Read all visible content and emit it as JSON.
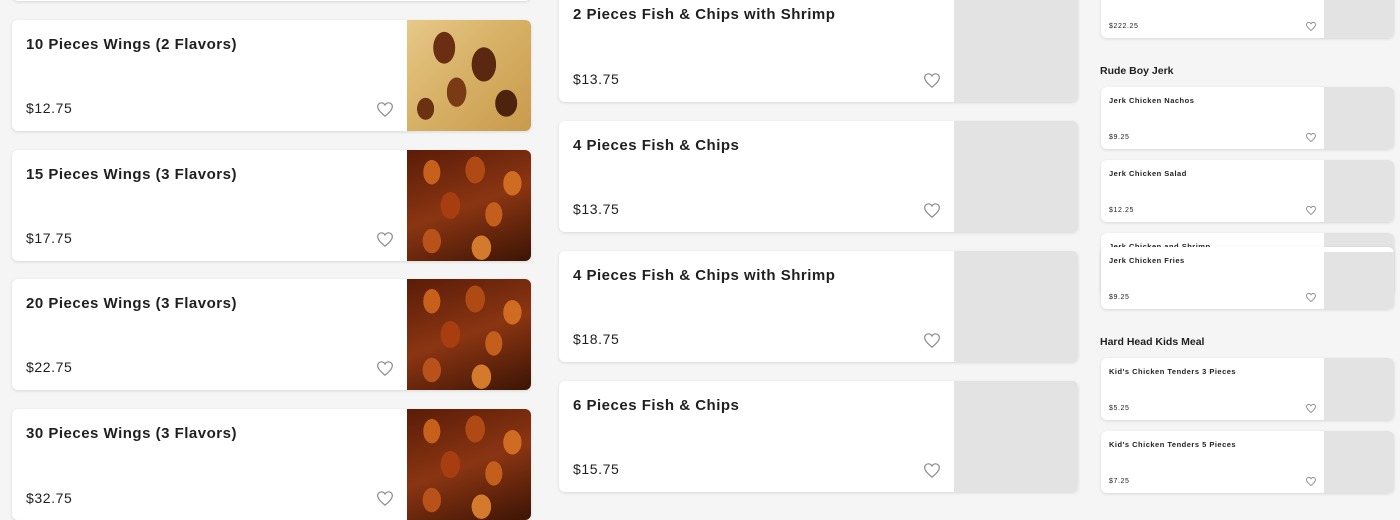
{
  "col1": {
    "items": [
      {
        "name": "10 Pieces Wings (2 Flavors)",
        "price": "$12.75"
      },
      {
        "name": "15 Pieces Wings (3 Flavors)",
        "price": "$17.75"
      },
      {
        "name": "20 Pieces Wings (3 Flavors)",
        "price": "$22.75"
      },
      {
        "name": "30 Pieces Wings (3 Flavors)",
        "price": "$32.75"
      }
    ]
  },
  "col2": {
    "items": [
      {
        "name": "2 Pieces Fish & Chips with Shrimp",
        "price": "$13.75"
      },
      {
        "name": "4 Pieces Fish & Chips",
        "price": "$13.75"
      },
      {
        "name": "4 Pieces Fish & Chips with Shrimp",
        "price": "$18.75"
      },
      {
        "name": "6 Pieces Fish & Chips",
        "price": "$15.75"
      }
    ]
  },
  "col3": {
    "top_item": {
      "price": "$222.25"
    },
    "sections": [
      {
        "title": "Rude Boy Jerk",
        "items": [
          {
            "name": "Jerk Chicken Nachos",
            "price": "$9.25"
          },
          {
            "name": "Jerk Chicken Salad",
            "price": "$12.25"
          },
          {
            "name": "Jerk Chicken and Shrimp"
          },
          {
            "name": "Jerk Chicken Fries",
            "price": "$9.25"
          }
        ]
      },
      {
        "title": "Hard Head Kids Meal",
        "items": [
          {
            "name": "Kid's Chicken Tenders 3 Pieces",
            "price": "$5.25"
          },
          {
            "name": "Kid's Chicken Tenders 5 Pieces",
            "price": "$7.25"
          }
        ]
      }
    ]
  },
  "icons": {
    "favorite": "heart-icon"
  },
  "colors": {
    "heart": "#8a8a8a",
    "placeholder": "#e3e3e3"
  }
}
